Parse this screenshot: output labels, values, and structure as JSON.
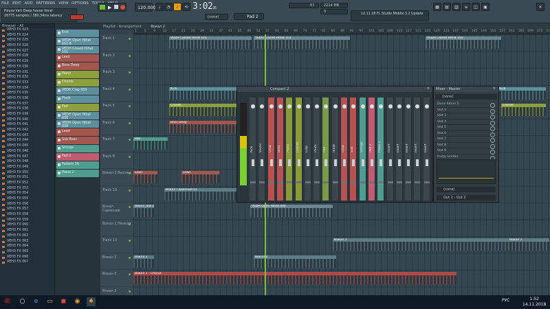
{
  "menu": [
    "FILE",
    "EDIT",
    "ADD",
    "PATTERNS",
    "VIEW",
    "OPTIONS",
    "TOOLS",
    "HELP"
  ],
  "project": {
    "title": "House Vart Deep house Vocal",
    "info": "16775 samples / 380.34ms latency"
  },
  "transport": {
    "tempo": "120.000",
    "time": "3:02",
    "time_frac": "16",
    "beat_label": "M:S:CS",
    "pattern": "Pad 2",
    "cpu": "67",
    "memory": "2214 MB",
    "voices": "0",
    "news": "12.11.18 FL Studio Mobile 3.2 Update",
    "snap": "(none)"
  },
  "browser": {
    "title": "Browser - All",
    "items": [
      "VEH3 FX 023",
      "VEH3 FX 024",
      "VEH3 FX 025",
      "VEH3 FX 026",
      "VEH3 FX 027",
      "VEH3 FX 028",
      "VEH3 FX 029",
      "VEH3 FX 030",
      "VEH3 FX 031",
      "VEH3 FX 032",
      "VEH3 FX 033",
      "VEH3 FX 034",
      "VEH3 FX 035",
      "VEH3 FX 036",
      "VEH3 FX 037",
      "VEH3 FX 038",
      "VEH3 FX 039",
      "VEH3 FX 040",
      "VEH3 FX 041",
      "VEH3 FX 042",
      "VEH3 FX 043",
      "VEH3 FX 044",
      "VEH3 FX 045",
      "VEH3 FX 046",
      "VEH3 FX 047",
      "VEH3 FX 048",
      "VEH3 FX 049",
      "VEH3 FX 050",
      "VEH3 FX 051",
      "VEH3 FX 052",
      "VEH3 FX 053",
      "VEH3 FX 054",
      "VEH3 FX 055",
      "VEH3 FX 056",
      "VEH3 FX 057",
      "VEH3 FX 058",
      "VEH3 FX 059",
      "VEH3 FX 060",
      "VEH3 FX 061",
      "VEH3 FX 062",
      "VEH3 FX 063",
      "VEH3 FX 064",
      "VEH3 FX 065",
      "VEH3 FX 066",
      "VEH3 FX 067"
    ]
  },
  "channels": [
    {
      "name": "Kick",
      "color": "#5e8f9d"
    },
    {
      "name": "VEDH Open Hihat 010 B",
      "color": "#5e8f9d"
    },
    {
      "name": "VEDH Closed Hihat 101",
      "color": "#5e8f9d"
    },
    {
      "name": "Lead",
      "color": "#a4574f"
    },
    {
      "name": "Bass Deep",
      "color": "#a4574f"
    },
    {
      "name": "Piano",
      "color": "#8ea03c"
    },
    {
      "name": "Chords",
      "color": "#8ea03c"
    },
    {
      "name": "VEDH Clap 059",
      "color": "#5e8f9d"
    },
    {
      "name": "Pluck",
      "color": "#5e8f9d"
    },
    {
      "name": "Pad",
      "color": "#8ea03c"
    },
    {
      "name": "VEDH Open Hihat 006",
      "color": "#5e8f9d"
    },
    {
      "name": "VEDH Open Hihat 008",
      "color": "#5e8f9d"
    },
    {
      "name": "Lead",
      "color": "#a4574f"
    },
    {
      "name": "Sub Bass",
      "color": "#a4574f"
    },
    {
      "name": "Strings",
      "color": "#4f9d8e"
    },
    {
      "name": "Pad 2",
      "color": "#c45a72"
    },
    {
      "name": "Pattern 16",
      "color": "#4f9d8e"
    },
    {
      "name": "Piano 2",
      "color": "#4f9d8e"
    }
  ],
  "playlist": {
    "title": "Playlist - Arrangement",
    "pattern": "Вокал 2",
    "tracks": [
      "Track 1",
      "Track 2",
      "Track 3",
      "Track 4",
      "Track 5",
      "Track 6",
      "Track 7",
      "Track 8",
      "Вокал 3 Высоки",
      "Track 10",
      "Вокал Гармония",
      "Вокал 1 Низкий",
      "Track 13",
      "Вокал 2",
      "Вокал 2",
      "Вокал 2"
    ],
    "ruler": [
      "1",
      "5",
      "9",
      "13",
      "17",
      "21",
      "25",
      "29",
      "33",
      "37",
      "41",
      "45",
      "49",
      "53",
      "57",
      "61",
      "65",
      "69",
      "73",
      "77",
      "81",
      "85",
      "89",
      "93",
      "97",
      "101",
      "105",
      "109",
      "113",
      "117",
      "121",
      "125",
      "129",
      "133",
      "137",
      "141",
      "145",
      "149",
      "153",
      "157",
      "161",
      "165",
      "169",
      "173",
      "177"
    ]
  },
  "clips": [
    {
      "label": "VEDH Closed Hihat 101",
      "color": "#6d8590"
    },
    {
      "label": "Kick",
      "color": "#5e8f9d"
    },
    {
      "label": "Chords",
      "color": "#8ea03c"
    },
    {
      "label": "Bass Deep",
      "color": "#a4574f"
    },
    {
      "label": "Pad",
      "color": "#4f9d8e"
    },
    {
      "label": "Lead",
      "color": "#a4574f"
    },
    {
      "label": "Вокал Гармония 01",
      "color": "#5e7c86"
    },
    {
      "label": "Вокал_low 01",
      "color": "#5e7c86"
    },
    {
      "label": "VEDH Open Hihat 006",
      "color": "#6d8590"
    },
    {
      "label": "Вокал 2",
      "color": "#5e7c86"
    },
    {
      "label": "Вокал 2 - Chorus",
      "color": "#b04a4a"
    }
  ],
  "mixer": {
    "title": "Compact 2",
    "strips": [
      "Kick",
      "VEDH",
      "Lead",
      "Bass",
      "Piano",
      "Chords",
      "Clap",
      "Pluck",
      "Pad",
      "Hihat",
      "Lead",
      "Sub",
      "Strings",
      "Pad 2",
      "Piano 2",
      "Insert",
      "Insert",
      "Insert",
      "Insert",
      "Insert"
    ]
  },
  "mixer_master": {
    "title": "Mixer - Master",
    "preset": "(none)",
    "slots": [
      "Dune Stone 5",
      "Slot 2",
      "Slot 3",
      "Slot 4",
      "Slot 5",
      "Slot 6",
      "Slot 7",
      "Slot 8",
      "Slot 9",
      "Fruity Limiter"
    ],
    "out_preset": "(none)",
    "output": "Out 1 - Out 2"
  },
  "taskbar": {
    "lang": "РУС",
    "time": "1:52",
    "date": "14.11.2018"
  }
}
